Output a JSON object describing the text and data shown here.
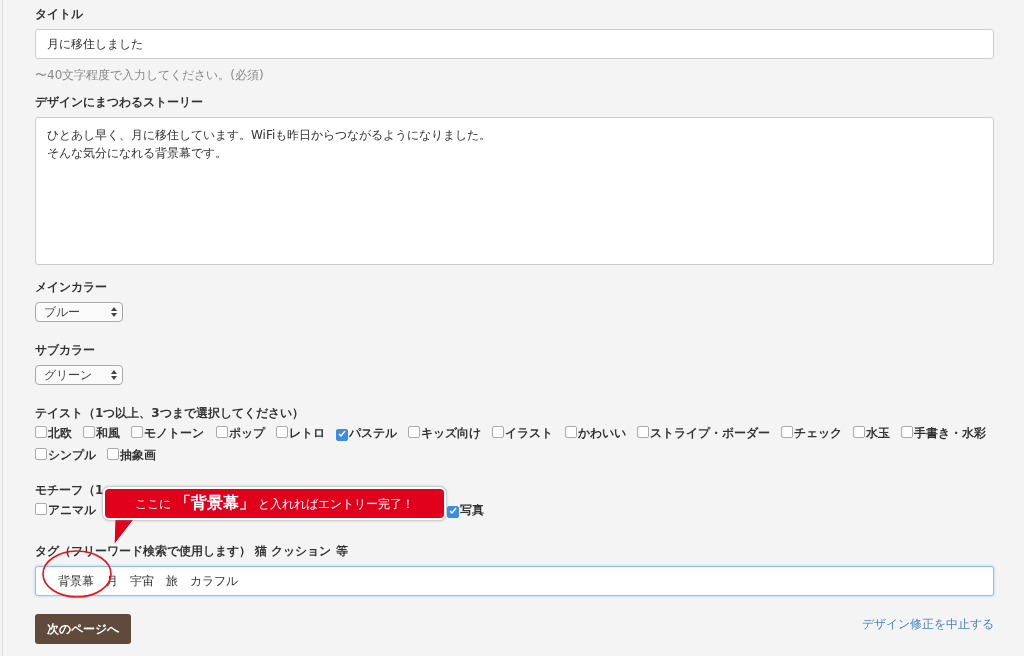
{
  "title_field": {
    "label": "タイトル",
    "value": "月に移住しました",
    "help": "〜40文字程度で入力してください。(必須)"
  },
  "story_field": {
    "label": "デザインにまつわるストーリー",
    "lines": [
      "ひとあし早く、月に移住しています。WiFiも昨日からつながるようになりました。",
      "そんな気分になれる背景幕です。"
    ]
  },
  "main_color": {
    "label": "メインカラー",
    "value": "ブルー"
  },
  "sub_color": {
    "label": "サブカラー",
    "value": "グリーン"
  },
  "taste": {
    "label": "テイスト（1つ以上、3つまで選択してください）",
    "options": [
      {
        "label": "北欧",
        "checked": false
      },
      {
        "label": "和風",
        "checked": false
      },
      {
        "label": "モノトーン",
        "checked": false
      },
      {
        "label": "ポップ",
        "checked": false
      },
      {
        "label": "レトロ",
        "checked": false
      },
      {
        "label": "パステル",
        "checked": true
      },
      {
        "label": "キッズ向け",
        "checked": false
      },
      {
        "label": "イラスト",
        "checked": false
      },
      {
        "label": "かわいい",
        "checked": false
      },
      {
        "label": "ストライプ・ボーダー",
        "checked": false
      },
      {
        "label": "チェック",
        "checked": false
      },
      {
        "label": "水玉",
        "checked": false
      },
      {
        "label": "手書き・水彩",
        "checked": false
      },
      {
        "label": "シンプル",
        "checked": false
      },
      {
        "label": "抽象画",
        "checked": false
      }
    ]
  },
  "motif": {
    "label": "モチーフ（1",
    "options": [
      {
        "label": "アニマル",
        "checked": false
      },
      {
        "label": "写真",
        "checked": true
      }
    ]
  },
  "tag_field": {
    "label": "タグ（フリーワード検索で使用します） 猫 クッション 等",
    "value": "背景幕　月　宇宙　旅　カラフル"
  },
  "next_button": "次のページへ",
  "cancel_link": "デザイン修正を中止する",
  "callout": {
    "text": "ここに **「背景幕」** と入れればエントリー完了！"
  }
}
